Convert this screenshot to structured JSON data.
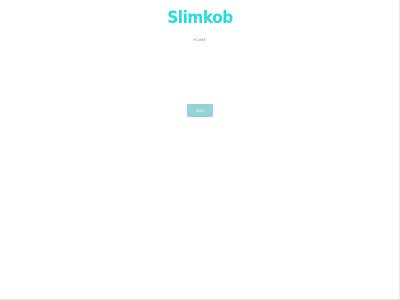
{
  "brand": {
    "name": "Slimkob"
  },
  "subtitle": "HOME",
  "action_button": {
    "label": "ADD"
  },
  "colors": {
    "brand": "#25dcdc",
    "button_bg": "#92d4d4",
    "background": "#ffffff"
  }
}
